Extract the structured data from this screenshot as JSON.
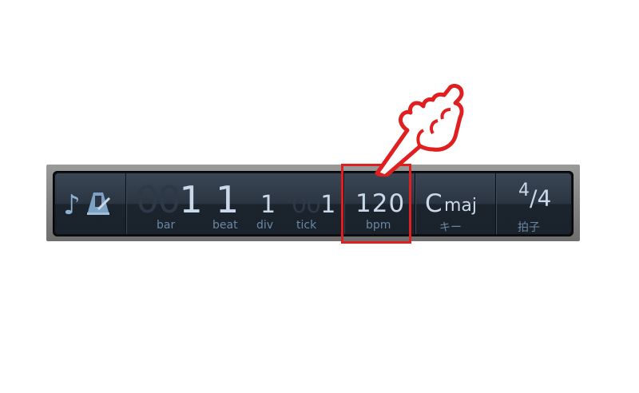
{
  "transport": {
    "icons": [
      "music-note-icon",
      "metronome-icon"
    ],
    "position": {
      "bar_dim": "00",
      "bar_value": "1",
      "bar_label": "bar",
      "beat_value": "1",
      "beat_label": "beat",
      "div_value": "1",
      "div_label": "div",
      "tick_dim": "00",
      "tick_value": "1",
      "tick_label": "tick"
    },
    "tempo": {
      "value": "120",
      "label": "bpm"
    },
    "key": {
      "root": "C",
      "mode": "maj",
      "label": "キー"
    },
    "time_signature": {
      "numerator": "4",
      "denominator": "4",
      "label": "拍子"
    }
  },
  "annotation": {
    "highlight_color": "#e02020",
    "pointer": "pointing-hand-icon"
  },
  "colors": {
    "lcd_text": "#c9d9ea",
    "lcd_label": "#6a87a4",
    "lcd_background": "#1a222b"
  }
}
